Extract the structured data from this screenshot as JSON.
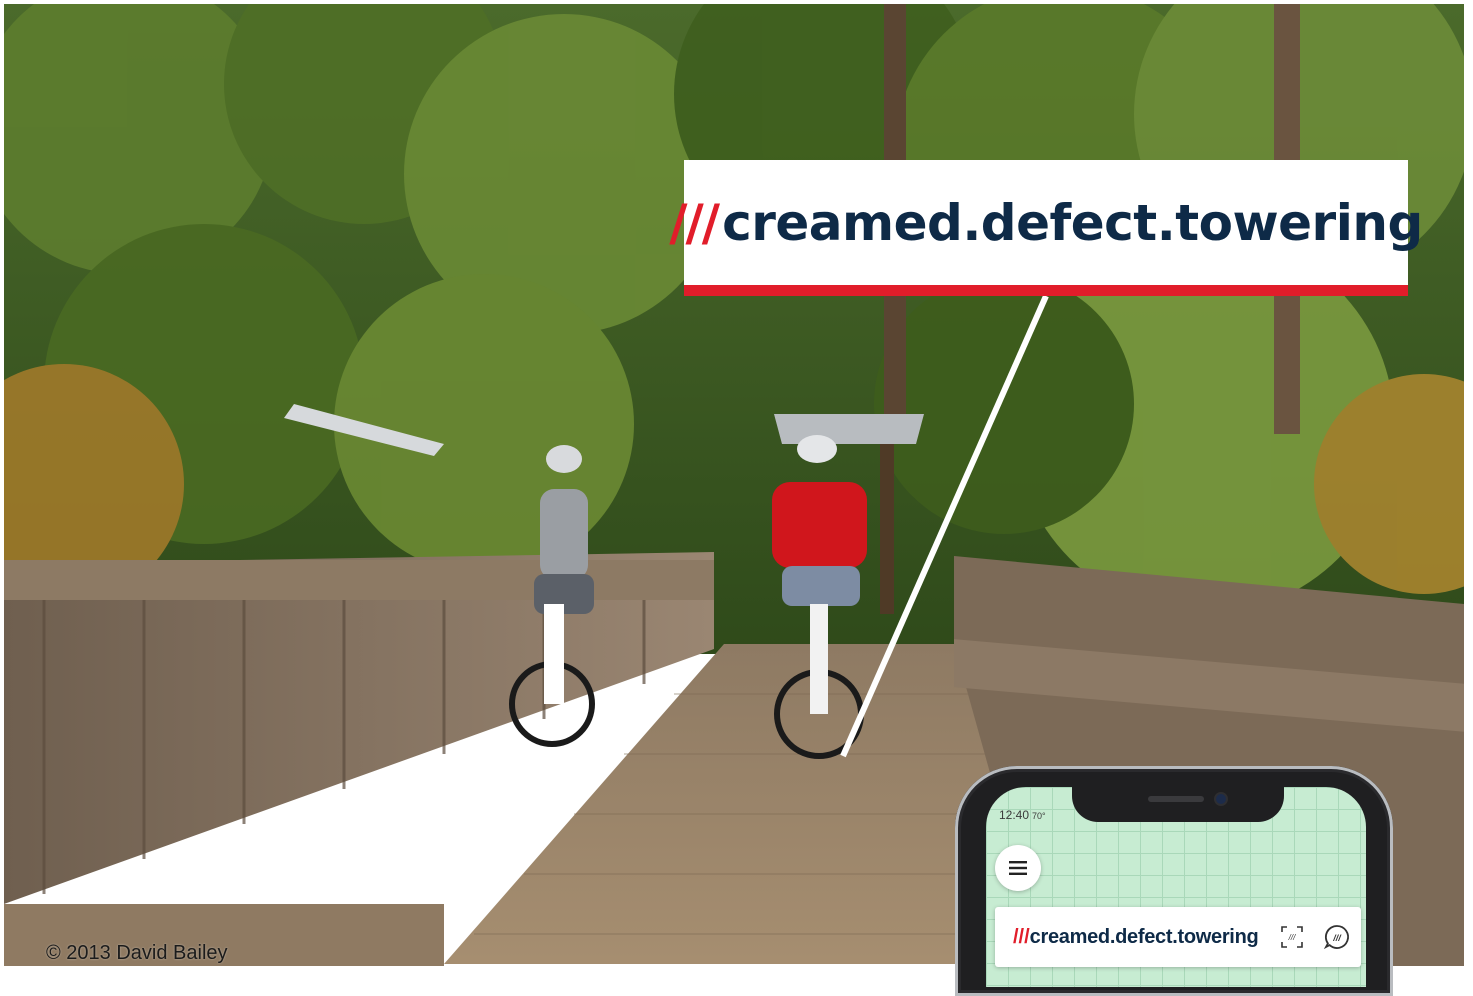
{
  "photo": {
    "description_icon": "photo-of-cyclists-on-boardwalk",
    "credit": "© 2013 David Bailey"
  },
  "callout": {
    "slashes": "///",
    "words": "creamed.defect.towering",
    "accent_color": "#e11d2a",
    "text_color": "#0e2a47"
  },
  "phone": {
    "status_time": "12:40",
    "status_temp": "70°",
    "menu_icon": "hamburger-icon",
    "search": {
      "slashes": "///",
      "words": "creamed.defect.towering"
    },
    "scan_icon": "scan-icon",
    "voice_icon": "voice-icon",
    "screen_color": "#c7ecd2"
  }
}
